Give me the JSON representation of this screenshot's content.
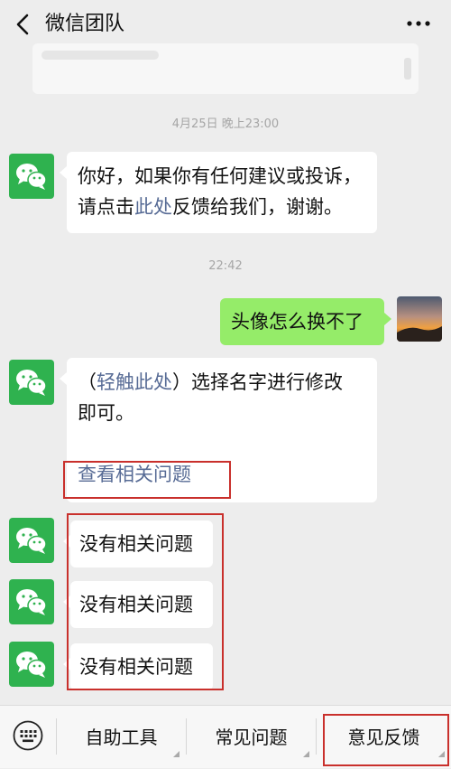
{
  "header": {
    "title": "微信团队",
    "back_icon": "chevron-left-icon",
    "more_icon": "more-dots-icon"
  },
  "timestamps": [
    "4月25日 晚上23:00",
    "22:42"
  ],
  "messages": {
    "m1_line1": "你好，如果你有任何建议或投诉，",
    "m1_line2_pre": "请点击",
    "m1_link": "此处",
    "m1_line2_post": "反馈给我们，谢谢。",
    "m2": "头像怎么换不了",
    "m3_open": "（",
    "m3_link": "轻触此处",
    "m3_close": "）选择名字进行修改",
    "m3_line2": "即可。",
    "m3_related": "查看相关问题",
    "m4": "没有相关问题",
    "m5": "没有相关问题",
    "m6": "没有相关问题"
  },
  "bottom_bar": {
    "keyboard_icon": "keyboard-icon",
    "items": [
      "自助工具",
      "常见问题",
      "意见反馈"
    ]
  },
  "colors": {
    "wechat_green": "#2fb24f",
    "sent_bubble": "#95ec69",
    "link": "#576b95",
    "highlight_box": "#c9302c"
  }
}
